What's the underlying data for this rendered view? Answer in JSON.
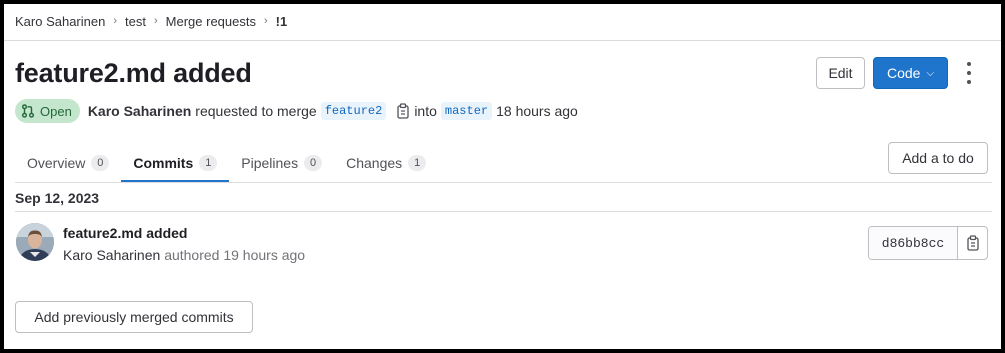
{
  "breadcrumb": [
    "Karo Saharinen",
    "test",
    "Merge requests",
    "!1"
  ],
  "title": "feature2.md added",
  "actions": {
    "edit_label": "Edit",
    "code_label": "Code",
    "todo_label": "Add a to do"
  },
  "meta": {
    "status": "Open",
    "author": "Karo Saharinen",
    "requested_text": "requested to merge",
    "source_branch": "feature2",
    "into_text": "into",
    "target_branch": "master",
    "time": "18 hours ago"
  },
  "tabs": [
    {
      "label": "Overview",
      "count": "0"
    },
    {
      "label": "Commits",
      "count": "1"
    },
    {
      "label": "Pipelines",
      "count": "0"
    },
    {
      "label": "Changes",
      "count": "1"
    }
  ],
  "commits": {
    "date": "Sep 12, 2023",
    "items": [
      {
        "title": "feature2.md added",
        "author": "Karo Saharinen",
        "authored_text": "authored 19 hours ago",
        "sha": "d86bb8cc"
      }
    ],
    "add_previous_label": "Add previously merged commits"
  },
  "colors": {
    "primary": "#1f75cb",
    "open_badge_bg": "#c3e6cd",
    "open_badge_fg": "#24663b"
  }
}
